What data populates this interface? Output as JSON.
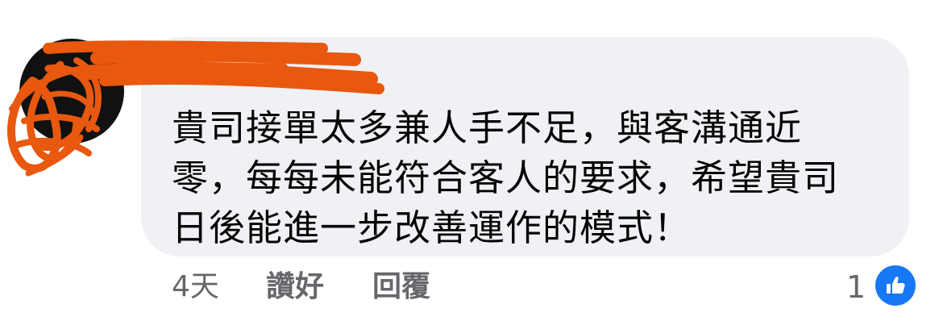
{
  "comment": {
    "author_redacted": true,
    "lines": [
      "貴司接單太多兼人手不足，與客溝通近",
      "零，每每未能符合客人的要求，希望貴司",
      "日後能進一步改善運作的模式！"
    ]
  },
  "actions": {
    "time": "4天",
    "like_label": "讚好",
    "reply_label": "回覆"
  },
  "reactions": {
    "count": "1",
    "icon": "thumbs-up-icon",
    "color": "#1877f2"
  },
  "colors": {
    "bubble": "#eff1f4",
    "redaction": "#e8580f",
    "text": "#050505",
    "meta": "#65676b"
  }
}
